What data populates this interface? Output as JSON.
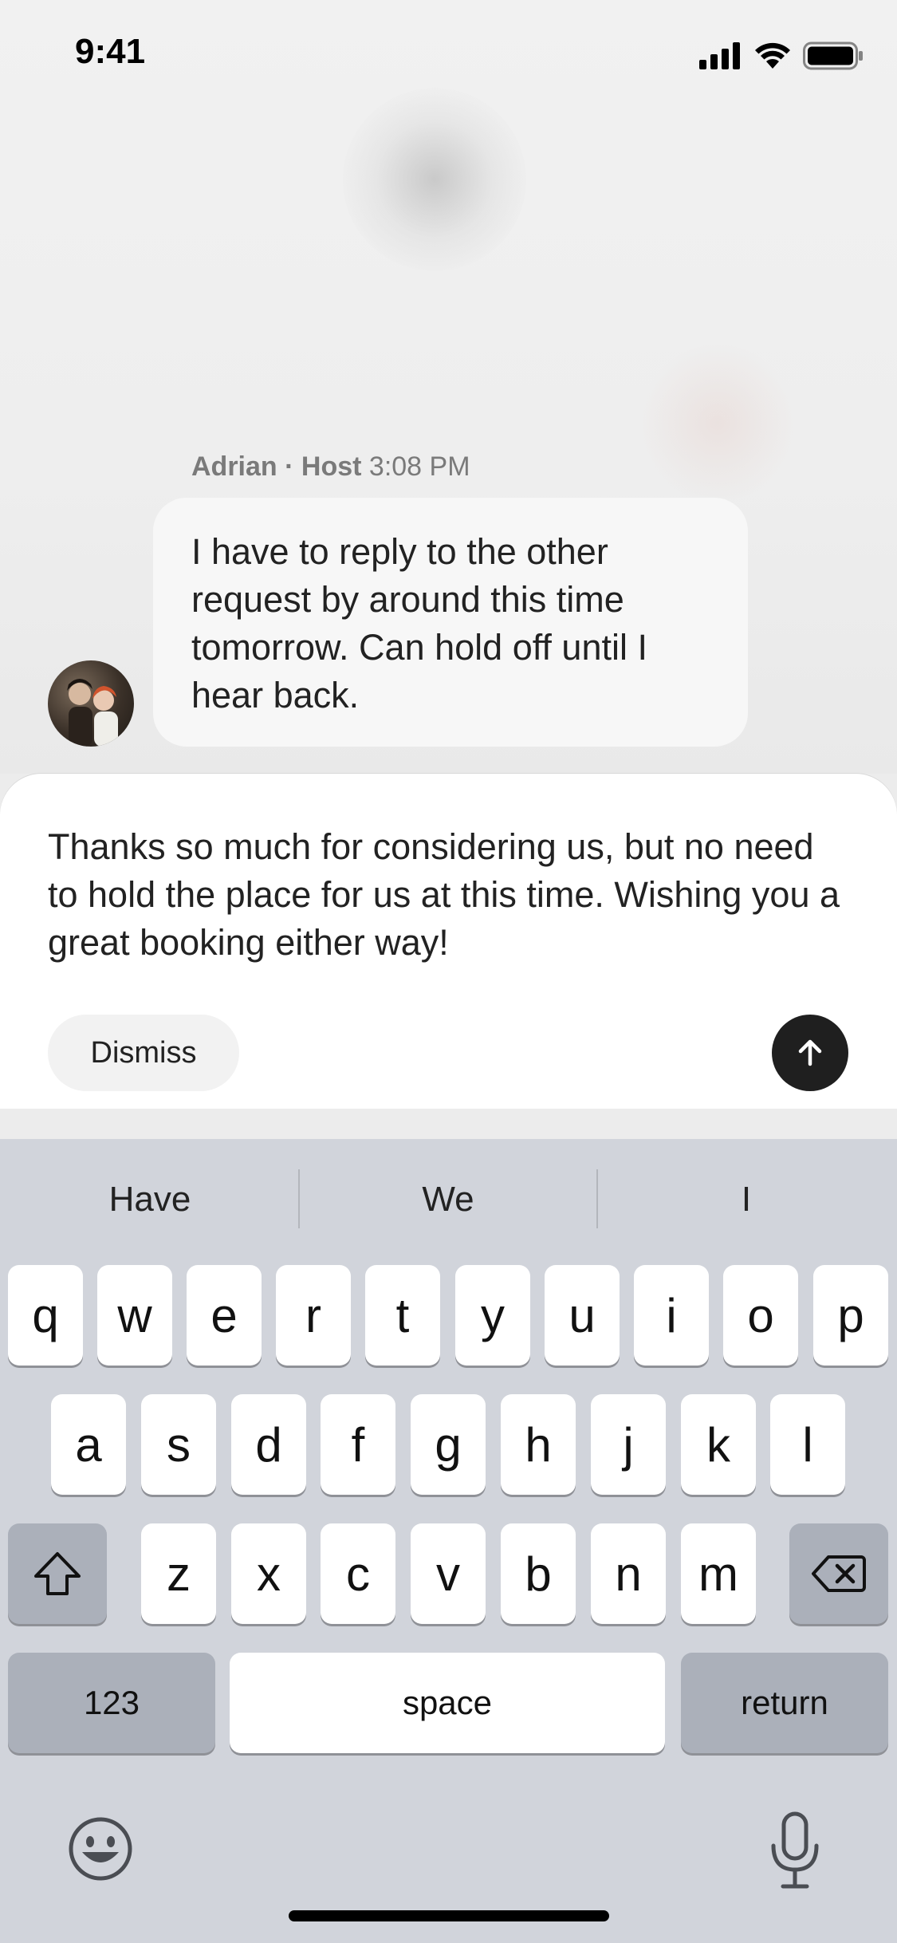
{
  "status_bar": {
    "time": "9:41"
  },
  "message": {
    "sender_name": "Adrian",
    "separator": " · ",
    "sender_role": "Host",
    "timestamp": "3:08 PM",
    "text": "I have to reply to the other request by around this time tomorrow. Can hold off until I hear back."
  },
  "compose": {
    "draft_text": "Thanks so much for considering us, but no need to hold the place for us at this time. Wishing you a great booking either way!",
    "dismiss_label": "Dismiss",
    "send_icon": "arrow-up-icon"
  },
  "keyboard": {
    "suggestions": [
      "Have",
      "We",
      "I"
    ],
    "row1": [
      "q",
      "w",
      "e",
      "r",
      "t",
      "y",
      "u",
      "i",
      "o",
      "p"
    ],
    "row2": [
      "a",
      "s",
      "d",
      "f",
      "g",
      "h",
      "j",
      "k",
      "l"
    ],
    "row3": [
      "z",
      "x",
      "c",
      "v",
      "b",
      "n",
      "m"
    ],
    "numbers_label": "123",
    "space_label": "space",
    "return_label": "return",
    "emoji_icon": "emoji-icon",
    "mic_icon": "microphone-icon"
  },
  "colors": {
    "send_button": "#1f1f1f",
    "keyboard_bg": "#d1d4db",
    "bubble_bg": "#f7f7f7"
  }
}
